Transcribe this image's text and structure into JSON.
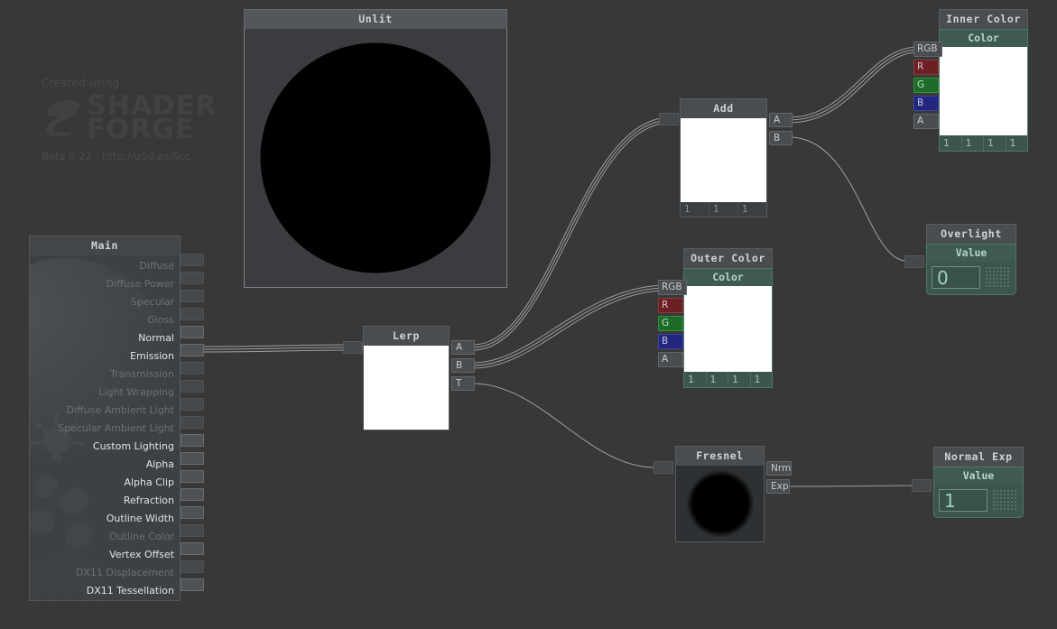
{
  "app": {
    "watermark": {
      "created_label": "Created using",
      "brand_line1": "SHADER",
      "brand_line2": "FORGE",
      "version_url": "Beta 0.22 - http://u3d.as/6cc"
    }
  },
  "nodes": {
    "main": {
      "title": "Main",
      "rows": [
        {
          "label": "Diffuse",
          "enabled": false,
          "connected": false
        },
        {
          "label": "Diffuse Power",
          "enabled": false,
          "connected": false
        },
        {
          "label": "Specular",
          "enabled": false,
          "connected": false
        },
        {
          "label": "Gloss",
          "enabled": false,
          "connected": false
        },
        {
          "label": "Normal",
          "enabled": true,
          "connected": false
        },
        {
          "label": "Emission",
          "enabled": true,
          "connected": true
        },
        {
          "label": "Transmission",
          "enabled": false,
          "connected": false
        },
        {
          "label": "Light Wrapping",
          "enabled": false,
          "connected": false
        },
        {
          "label": "Diffuse Ambient Light",
          "enabled": false,
          "connected": false
        },
        {
          "label": "Specular Ambient Light",
          "enabled": false,
          "connected": false
        },
        {
          "label": "Custom Lighting",
          "enabled": true,
          "connected": false
        },
        {
          "label": "Alpha",
          "enabled": true,
          "connected": false
        },
        {
          "label": "Alpha Clip",
          "enabled": true,
          "connected": false
        },
        {
          "label": "Refraction",
          "enabled": true,
          "connected": false
        },
        {
          "label": "Outline Width",
          "enabled": true,
          "connected": false
        },
        {
          "label": "Outline Color",
          "enabled": false,
          "connected": false
        },
        {
          "label": "Vertex Offset",
          "enabled": true,
          "connected": false
        },
        {
          "label": "DX11 Displacement",
          "enabled": false,
          "connected": false
        },
        {
          "label": "DX11 Tessellation",
          "enabled": true,
          "connected": false
        }
      ]
    },
    "unlit": {
      "title": "Unlit"
    },
    "lerp": {
      "title": "Lerp",
      "outputs": [
        "A",
        "B",
        "T"
      ]
    },
    "add": {
      "title": "Add",
      "outputs": [
        "A",
        "B"
      ],
      "values": [
        "1",
        "1",
        "1"
      ]
    },
    "inner_color": {
      "title": "Inner Color",
      "sub_title": "Color",
      "channels": [
        "RGB",
        "R",
        "G",
        "B",
        "A"
      ],
      "values": [
        "1",
        "1",
        "1",
        "1"
      ]
    },
    "outer_color": {
      "title": "Outer Color",
      "sub_title": "Color",
      "channels": [
        "RGB",
        "R",
        "G",
        "B",
        "A"
      ],
      "values": [
        "1",
        "1",
        "1",
        "1"
      ]
    },
    "overlight": {
      "title": "Overlight",
      "sub_title": "Value",
      "value": "0"
    },
    "normal_exp": {
      "title": "Normal Exp",
      "sub_title": "Value",
      "value": "1"
    },
    "fresnel": {
      "title": "Fresnel",
      "outputs": [
        "Nrm",
        "Exp"
      ]
    }
  },
  "colors": {
    "background": "#383838",
    "node_header": "#4a4d50",
    "node_body": "#3c3f42",
    "property_accent": "#3f5a51",
    "wire": "#b0b0b0",
    "channel_r": "#6d2024",
    "channel_g": "#1d6b28",
    "channel_b": "#23267d"
  }
}
